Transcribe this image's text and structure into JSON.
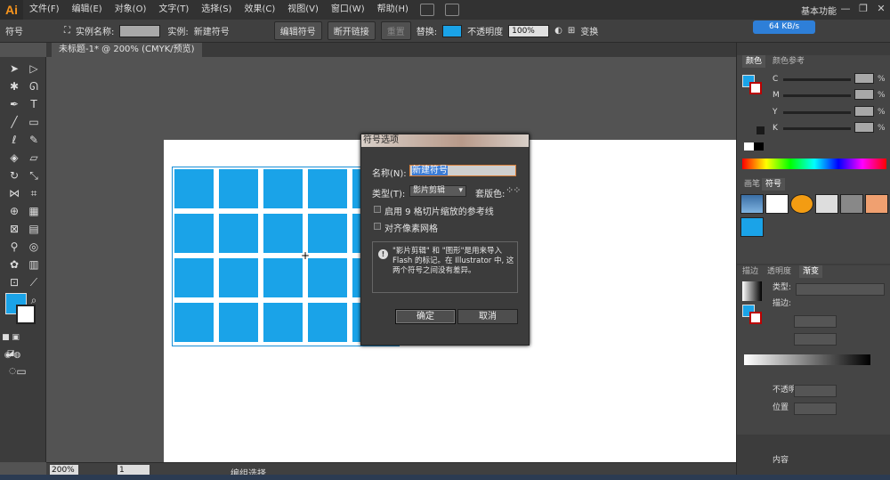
{
  "app": {
    "logo": "Ai"
  },
  "menu": [
    "文件(F)",
    "编辑(E)",
    "对象(O)",
    "文字(T)",
    "选择(S)",
    "效果(C)",
    "视图(V)",
    "窗口(W)",
    "帮助(H)"
  ],
  "workspace": "基本功能",
  "speed_badge": "64 KB/s",
  "control": {
    "kind": "符号",
    "instance_name_label": "实例名称:",
    "instance_label": "实例:",
    "instance_value": "新建符号",
    "edit_symbol": "编辑符号",
    "break_link": "断开链接",
    "reset": "重置",
    "replace_label": "替换:",
    "opacity_label": "不透明度",
    "opacity_value": "100%",
    "transform": "变换"
  },
  "document_tab": "未标题-1* @ 200% (CMYK/预览)",
  "dialog": {
    "title": "符号选项",
    "name_label": "名称(N):",
    "name_value": "新建符号",
    "type_label": "类型(T):",
    "type_value": "影片剪辑",
    "registration_label": "套版色:",
    "checkbox_9slice": "启用 9 格切片缩放的参考线",
    "checkbox_pixel": "对齐像素网格",
    "info": "\"影片剪辑\" 和 \"图形\"是用来导入 Flash 的标记。在 Illustrator 中, 这两个符号之间没有差异。",
    "ok": "确定",
    "cancel": "取消"
  },
  "panels": {
    "color_tab": "颜色",
    "color_ref_tab": "颜色参考",
    "cmyk": [
      "C",
      "M",
      "Y",
      "K"
    ],
    "percent": "%",
    "brushes_tab": "画笔",
    "symbols_tab": "符号",
    "stroke_tab": "描边",
    "transparency_tab": "透明度",
    "gradient_tab": "渐变",
    "gradient_type_label": "类型:",
    "gradient_stroke_label": "描边:",
    "opacity_label": "不透明度",
    "position_label": "位置",
    "content_label": "内容"
  },
  "status": {
    "zoom": "200%",
    "page": "1",
    "mode": "编组选择"
  },
  "colors": {
    "accent_fill": "#1aa3e8",
    "opacity_label": "#f29a2e",
    "badge": "#2e7fd8"
  }
}
